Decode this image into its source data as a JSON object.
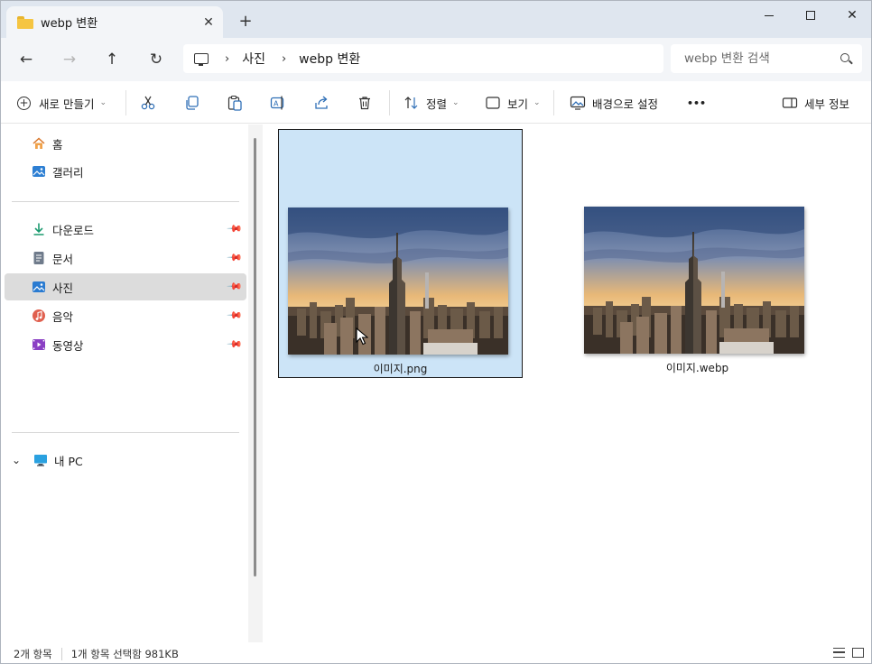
{
  "window": {
    "tab_title": "webp 변환",
    "tab_close": "✕",
    "new_tab": "+",
    "controls": {
      "close": "✕"
    }
  },
  "nav": {
    "back": "←",
    "forward": "→",
    "up": "↑",
    "refresh": "↻"
  },
  "address": {
    "separator": "›",
    "breadcrumbs": [
      "사진",
      "webp 변환"
    ]
  },
  "search": {
    "placeholder": "webp 변환 검색"
  },
  "toolbar": {
    "new_label": "새로 만들기",
    "sort_label": "정렬",
    "view_label": "보기",
    "set_background_label": "배경으로 설정",
    "more_label": "•••",
    "details_label": "세부 정보",
    "chevron": "⌄"
  },
  "sidebar": {
    "quick": [
      {
        "label": "홈",
        "icon": "home-icon",
        "pinned": false
      },
      {
        "label": "갤러리",
        "icon": "gallery-icon",
        "pinned": false
      }
    ],
    "pinned": [
      {
        "label": "다운로드",
        "icon": "download-icon"
      },
      {
        "label": "문서",
        "icon": "documents-icon"
      },
      {
        "label": "사진",
        "icon": "pictures-icon",
        "selected": true
      },
      {
        "label": "음악",
        "icon": "music-icon"
      },
      {
        "label": "동영상",
        "icon": "videos-icon"
      }
    ],
    "this_pc": {
      "label": "내 PC",
      "expand": "⌄"
    }
  },
  "files": [
    {
      "name": "이미지.png",
      "selected": true
    },
    {
      "name": "이미지.webp",
      "selected": false
    }
  ],
  "status": {
    "item_count": "2개 항목",
    "selection": "1개 항목 선택함 981KB"
  },
  "colors": {
    "accent": "#0067c0",
    "selection_bg": "#cce4f7",
    "titlebar_bg": "#dfe6ef"
  }
}
